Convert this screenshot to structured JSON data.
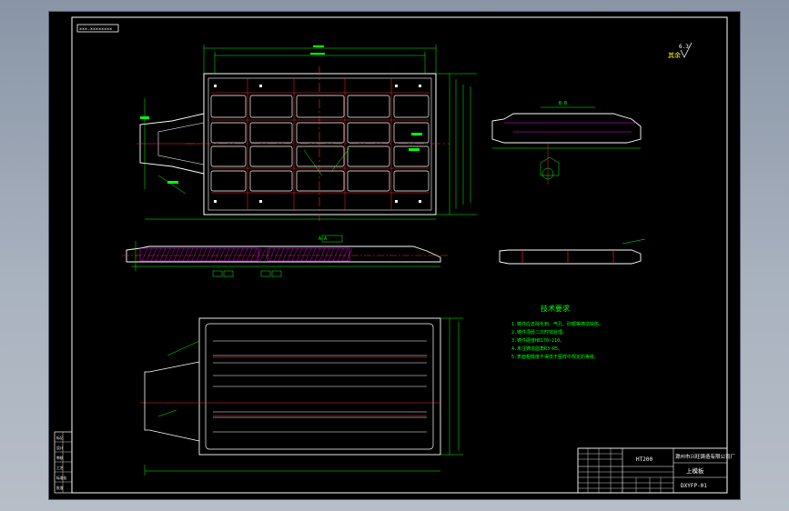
{
  "drawing": {
    "top_left_tag": "×××-××××××××",
    "tech_req": {
      "title": "技术要求",
      "items": [
        "1.铸件应去除毛刺、气孔、砂眼等铸造缺陷。",
        "2.铸件须经二次时效处理。",
        "3.铸件硬度HB170~210。",
        "4.未注铸造圆角R3~R5。",
        "5.表面粗糙度不得低于图样中规定的等级。"
      ]
    },
    "title_block": {
      "material": "HT200",
      "company": "滁州市兴旺铸造有限公司厂",
      "part_name": "上模板",
      "drawing_no": "DXYFP-01"
    },
    "roughness_note": "其余",
    "roughness_value": "6.3",
    "section_tags": [
      "A-A",
      "B-B"
    ],
    "left_strip_labels": [
      "标记",
      "设计",
      "审核",
      "工艺",
      "标准化",
      "批准"
    ],
    "colors": {
      "background": "#000000",
      "geometry": "#ffffff",
      "dimension": "#00ff00",
      "centerline": "#ff2a2a",
      "hatch": "#ff00ff",
      "annotation": "#ffff00",
      "window_frame": "#9aa3b0"
    }
  }
}
